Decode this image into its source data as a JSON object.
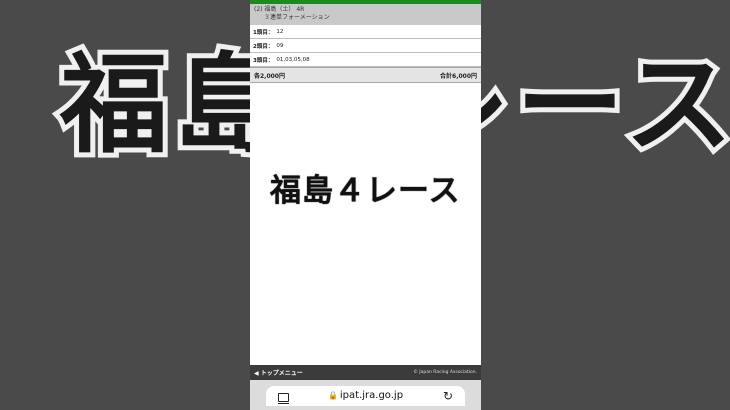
{
  "background_caption": "福島４レース",
  "race": {
    "line1": "(2) 福島（土） 4R",
    "line2": "３連単フォーメーション"
  },
  "selections": [
    {
      "label": "1頭目：",
      "value": "12"
    },
    {
      "label": "2頭目：",
      "value": "09"
    },
    {
      "label": "3頭目：",
      "value": "01,03,05,08"
    }
  ],
  "totals": {
    "each": "各2,000円",
    "sum": "合計6,000円"
  },
  "overlay_caption": "福島４レース",
  "footer": {
    "menu": "◀ トップメニュー",
    "copyright": "© Japan Racing Association."
  },
  "browser": {
    "url": "ipat.jra.go.jp",
    "tabs_icon": "tabs-icon",
    "lock_icon": "lock-icon",
    "reload_icon": "reload-icon"
  },
  "colors": {
    "accent_green": "#1e8a1e",
    "header_gray": "#c9c9c9",
    "footer_dark": "#3b3b3b"
  }
}
